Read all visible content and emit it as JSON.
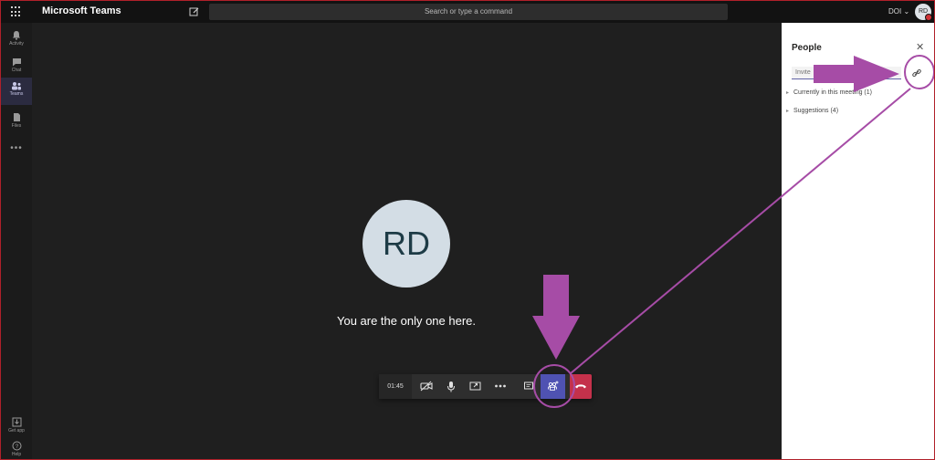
{
  "app": {
    "title": "Microsoft Teams"
  },
  "search": {
    "placeholder": "Search or type a command"
  },
  "user": {
    "label": "DOI",
    "initials": "RD"
  },
  "rail": {
    "items": [
      {
        "label": "Activity",
        "icon": "bell-icon"
      },
      {
        "label": "Chat",
        "icon": "chat-icon"
      },
      {
        "label": "Teams",
        "icon": "teams-icon",
        "active": true
      },
      {
        "label": "Files",
        "icon": "files-icon"
      }
    ],
    "more": "•••",
    "get_app": "Get app",
    "help": "Help"
  },
  "meeting": {
    "avatar_initials": "RD",
    "message": "You are the only one here.",
    "timer": "01:45"
  },
  "people_panel": {
    "title": "People",
    "close": "✕",
    "invite_placeholder": "Invite",
    "sections": [
      "Currently in this meeting (1)",
      "Suggestions (4)"
    ]
  },
  "colors": {
    "accent": "#6264a7",
    "hangup": "#c4314b",
    "annotation": "#a64ca6"
  }
}
